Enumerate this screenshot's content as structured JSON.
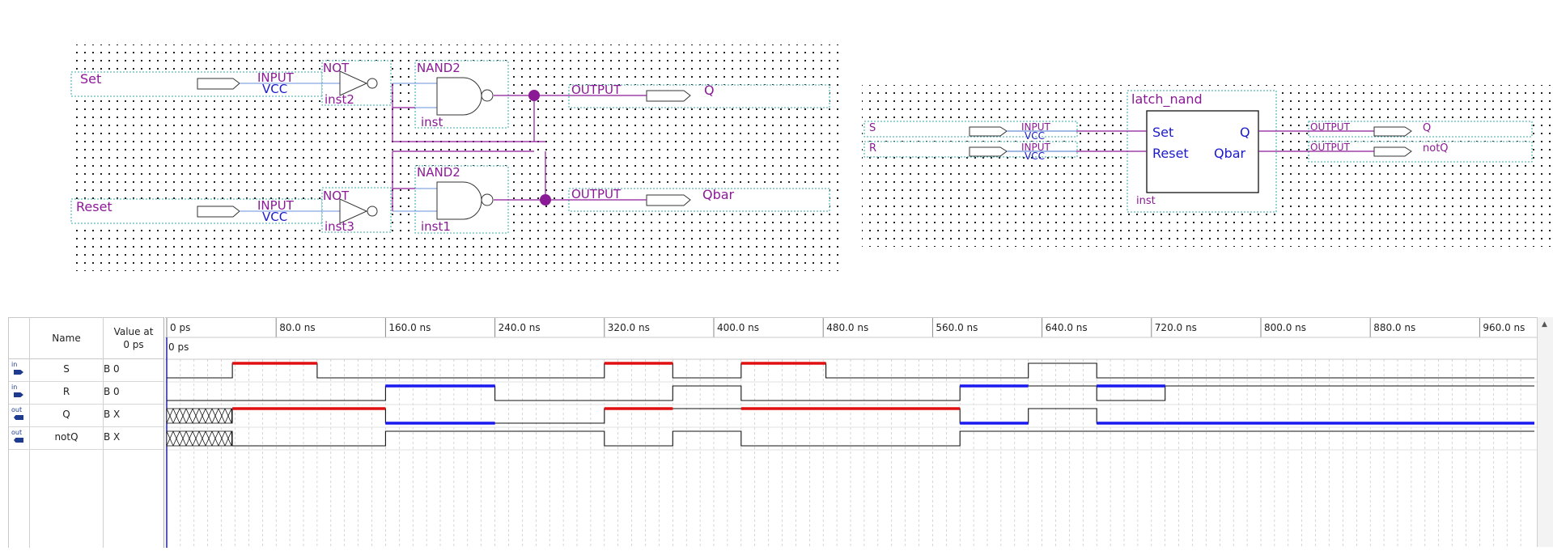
{
  "colors": {
    "purple": "#8b1a96",
    "blue": "#1a1acc",
    "red": "#e01010",
    "wave_blue": "#1a1af0",
    "wire_blue": "#6a8fd8"
  },
  "schematic_left": {
    "set_label": "Set",
    "reset_label": "Reset",
    "input_label": "INPUT",
    "vcc_label": "VCC",
    "not_label": "NOT",
    "nand_label": "NAND2",
    "output_label": "OUTPUT",
    "inst_not_top": "inst2",
    "inst_not_bottom": "inst3",
    "inst_nand_top": "inst",
    "inst_nand_bottom": "inst1",
    "out_q": "Q",
    "out_qbar": "Qbar"
  },
  "schematic_right": {
    "s_label": "S",
    "r_label": "R",
    "input_label": "INPUT",
    "vcc_label": "VCC",
    "block_title": "latch_nand",
    "port_set": "Set",
    "port_reset": "Reset",
    "port_q": "Q",
    "port_qbar": "Qbar",
    "inst": "inst",
    "output_label": "OUTPUT",
    "out_q": "Q",
    "out_notq": "notQ"
  },
  "waveform": {
    "header_name": "Name",
    "header_value_line1": "Value at",
    "header_value_line2": "0 ps",
    "cursor_label": "0 ps",
    "time_labels": [
      "0 ps",
      "80.0 ns",
      "160.0 ns",
      "240.0 ns",
      "320.0 ns",
      "400.0 ns",
      "480.0 ns",
      "560.0 ns",
      "640.0 ns",
      "720.0 ns",
      "800.0 ns",
      "880.0 ns",
      "960.0 ns"
    ],
    "signals": [
      {
        "dir": "in",
        "name": "S",
        "value": "B 0"
      },
      {
        "dir": "in",
        "name": "R",
        "value": "B 0"
      },
      {
        "dir": "out",
        "name": "Q",
        "value": "B X"
      },
      {
        "dir": "out",
        "name": "notQ",
        "value": "B X"
      }
    ]
  }
}
